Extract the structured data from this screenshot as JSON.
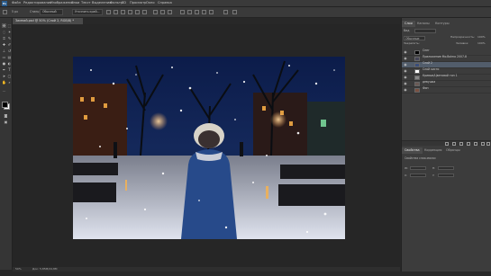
{
  "app": {
    "logo": "Ps"
  },
  "menu": [
    "Файл",
    "Редактирование",
    "Изображение",
    "Слои",
    "Текст",
    "Выделение",
    "Фильтр",
    "3D",
    "Просмотр",
    "Окно",
    "Справка"
  ],
  "options": {
    "style_label": "Стиль:",
    "style_value": "Обычный",
    "size_value": "5 px",
    "refine_button": "Уточнить край..."
  },
  "document": {
    "tab_title": "Зимний.psd @ 50% (Слой 2, RGB/8) *",
    "zoom": "50%",
    "doc_size": "Док: 5,85M/24,8M"
  },
  "layers_panel": {
    "tabs": [
      "Слои",
      "Каналы",
      "Контуры"
    ],
    "search_label": "Вид",
    "blend_mode": "Обычные",
    "opacity_label": "Непрозрачность:",
    "opacity": "100%",
    "fill_label": "Заливка:",
    "fill": "100%",
    "lock_label": "Закрепить:",
    "layers": [
      {
        "name": "Снег",
        "visible": true,
        "selected": false
      },
      {
        "name": "Приложение Mo.Bolmo 2007-8",
        "visible": true,
        "selected": false
      },
      {
        "name": "Слой 2",
        "visible": true,
        "selected": true
      },
      {
        "name": "Слой кисти",
        "visible": true,
        "selected": false
      },
      {
        "name": "Кривые/Цветовой тон 1",
        "visible": true,
        "selected": false
      },
      {
        "name": "девушка",
        "visible": true,
        "selected": false
      },
      {
        "name": "Фон",
        "visible": true,
        "selected": false
      }
    ]
  },
  "properties_panel": {
    "tabs": [
      "Свойства",
      "Коррекция",
      "Образцы"
    ],
    "title": "Свойства слоя-маски",
    "field_w": "W:",
    "field_h": "H:",
    "field_x": "X:",
    "field_y": "Y:"
  },
  "colors": {
    "accent": "#2a5d8f",
    "selected_layer": "#525d6b",
    "foreground": "#000000",
    "background": "#ffffff"
  }
}
